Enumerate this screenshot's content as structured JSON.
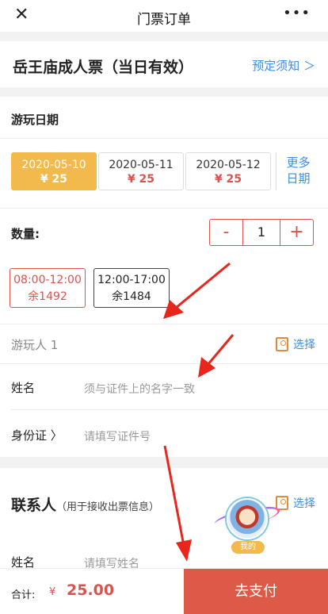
{
  "nav": {
    "close_icon": "close-icon",
    "title": "门票订单",
    "more_icon": "more-icon"
  },
  "product": {
    "name": "岳王庙成人票（当日有效）",
    "notice": "预定须知 ＞"
  },
  "date_section": {
    "title": "游玩日期",
    "dates": [
      {
        "date": "2020-05-10",
        "price": "¥ 25",
        "selected": true
      },
      {
        "date": "2020-05-11",
        "price": "¥ 25",
        "selected": false
      },
      {
        "date": "2020-05-12",
        "price": "¥ 25",
        "selected": false
      }
    ],
    "more_line1": "更多",
    "more_line2": "日期"
  },
  "quantity": {
    "label": "数量:",
    "minus": "-",
    "value": "1",
    "plus": "+"
  },
  "time_slots": [
    {
      "time": "08:00-12:00",
      "remain": "余1492",
      "selected": true
    },
    {
      "time": "12:00-17:00",
      "remain": "余1484",
      "selected": false
    }
  ],
  "visitor": {
    "title": "游玩人 1",
    "pick": "选择",
    "name_label": "姓名",
    "name_placeholder": "须与证件上的名字一致",
    "id_label": "身份证 〉",
    "id_placeholder": "请填写证件号"
  },
  "contact": {
    "title": "联系人",
    "subtitle": "（用于接收出票信息）",
    "pick": "选择",
    "name_label": "姓名",
    "name_placeholder": "请填写姓名"
  },
  "floater": {
    "tag": "我的"
  },
  "footer": {
    "total_label": "合计:",
    "currency": "¥",
    "amount": "25.00",
    "pay_button": "去支付"
  },
  "colors": {
    "accent": "#f2b94c",
    "price": "#d9534f",
    "link": "#3a8ee6",
    "pay": "#dc5a47"
  }
}
